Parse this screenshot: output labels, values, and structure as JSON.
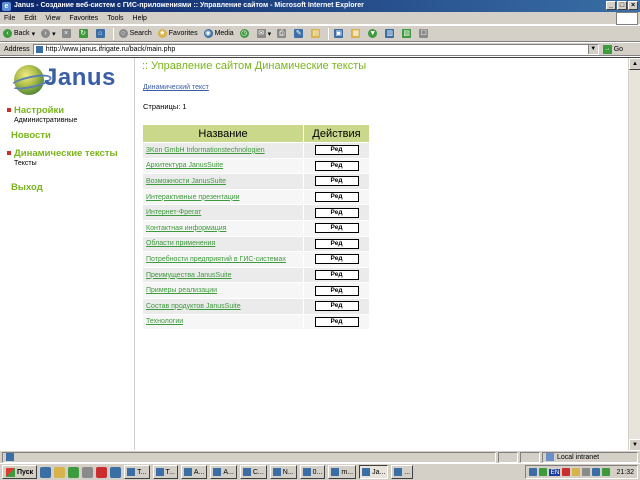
{
  "window": {
    "title": "Janus - Создание веб-систем с ГИС-приложениями :: Управление сайтом - Microsoft Internet Explorer",
    "minimize": "_",
    "maximize": "□",
    "close": "×"
  },
  "menu": [
    "File",
    "Edit",
    "View",
    "Favorites",
    "Tools",
    "Help"
  ],
  "toolbar": {
    "back_label": "Back",
    "search_label": "Search",
    "favorites_label": "Favorites",
    "media_label": "Media"
  },
  "address": {
    "label": "Address",
    "url": "http://www.janus.ifrigate.ru/back/main.php",
    "go_label": "Go"
  },
  "sidebar": {
    "logo_text": "Janus",
    "items": [
      {
        "title": "Настройки",
        "sub": "Административные"
      },
      {
        "title": "Новости",
        "sub": ""
      },
      {
        "title": "Динамические тексты",
        "sub": "Тексты"
      },
      {
        "title": "Выход",
        "sub": ""
      }
    ]
  },
  "main": {
    "page_title": ":: Управление сайтом Динамические тексты",
    "breadcrumb": "Динамический текст",
    "pages_label": "Страницы: 1",
    "columns": [
      "Название",
      "Действия"
    ],
    "edit_label": "Ред",
    "rows": [
      "3Kon GmbH Informationstechnologien",
      "Архитектура JanusSuite",
      "Возможности JanusSuite",
      "Интерактивные презентации",
      "Интернет-Фрегат",
      "Контактная информация",
      "Области применения",
      "Потребности предприятий в ГИС-системах",
      "Преимущества JanusSuite",
      "Примеры реализации",
      "Состав продуктов JanusSuite",
      "Технологии"
    ]
  },
  "status": {
    "zone_label": "Local intranet"
  },
  "taskbar": {
    "start_label": "Пуск",
    "tasks": [
      "Т...",
      "Т...",
      "А...",
      "А...",
      "С...",
      "N...",
      "0...",
      "m...",
      "Ja...",
      "..."
    ],
    "lang": "EN",
    "clock": "21:32"
  },
  "colors": {
    "accent_green": "#7ab51d",
    "header_bg": "#c9d88a",
    "link_green": "#3d9a3d"
  }
}
